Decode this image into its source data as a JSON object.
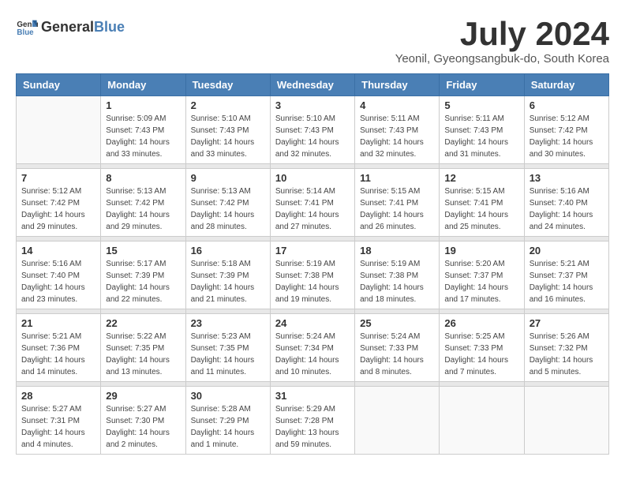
{
  "header": {
    "logo_general": "General",
    "logo_blue": "Blue",
    "month_title": "July 2024",
    "subtitle": "Yeonil, Gyeongsangbuk-do, South Korea"
  },
  "days_of_week": [
    "Sunday",
    "Monday",
    "Tuesday",
    "Wednesday",
    "Thursday",
    "Friday",
    "Saturday"
  ],
  "weeks": [
    {
      "days": [
        {
          "num": "",
          "sunrise": "",
          "sunset": "",
          "daylight": ""
        },
        {
          "num": "1",
          "sunrise": "Sunrise: 5:09 AM",
          "sunset": "Sunset: 7:43 PM",
          "daylight": "Daylight: 14 hours and 33 minutes."
        },
        {
          "num": "2",
          "sunrise": "Sunrise: 5:10 AM",
          "sunset": "Sunset: 7:43 PM",
          "daylight": "Daylight: 14 hours and 33 minutes."
        },
        {
          "num": "3",
          "sunrise": "Sunrise: 5:10 AM",
          "sunset": "Sunset: 7:43 PM",
          "daylight": "Daylight: 14 hours and 32 minutes."
        },
        {
          "num": "4",
          "sunrise": "Sunrise: 5:11 AM",
          "sunset": "Sunset: 7:43 PM",
          "daylight": "Daylight: 14 hours and 32 minutes."
        },
        {
          "num": "5",
          "sunrise": "Sunrise: 5:11 AM",
          "sunset": "Sunset: 7:43 PM",
          "daylight": "Daylight: 14 hours and 31 minutes."
        },
        {
          "num": "6",
          "sunrise": "Sunrise: 5:12 AM",
          "sunset": "Sunset: 7:42 PM",
          "daylight": "Daylight: 14 hours and 30 minutes."
        }
      ]
    },
    {
      "days": [
        {
          "num": "7",
          "sunrise": "Sunrise: 5:12 AM",
          "sunset": "Sunset: 7:42 PM",
          "daylight": "Daylight: 14 hours and 29 minutes."
        },
        {
          "num": "8",
          "sunrise": "Sunrise: 5:13 AM",
          "sunset": "Sunset: 7:42 PM",
          "daylight": "Daylight: 14 hours and 29 minutes."
        },
        {
          "num": "9",
          "sunrise": "Sunrise: 5:13 AM",
          "sunset": "Sunset: 7:42 PM",
          "daylight": "Daylight: 14 hours and 28 minutes."
        },
        {
          "num": "10",
          "sunrise": "Sunrise: 5:14 AM",
          "sunset": "Sunset: 7:41 PM",
          "daylight": "Daylight: 14 hours and 27 minutes."
        },
        {
          "num": "11",
          "sunrise": "Sunrise: 5:15 AM",
          "sunset": "Sunset: 7:41 PM",
          "daylight": "Daylight: 14 hours and 26 minutes."
        },
        {
          "num": "12",
          "sunrise": "Sunrise: 5:15 AM",
          "sunset": "Sunset: 7:41 PM",
          "daylight": "Daylight: 14 hours and 25 minutes."
        },
        {
          "num": "13",
          "sunrise": "Sunrise: 5:16 AM",
          "sunset": "Sunset: 7:40 PM",
          "daylight": "Daylight: 14 hours and 24 minutes."
        }
      ]
    },
    {
      "days": [
        {
          "num": "14",
          "sunrise": "Sunrise: 5:16 AM",
          "sunset": "Sunset: 7:40 PM",
          "daylight": "Daylight: 14 hours and 23 minutes."
        },
        {
          "num": "15",
          "sunrise": "Sunrise: 5:17 AM",
          "sunset": "Sunset: 7:39 PM",
          "daylight": "Daylight: 14 hours and 22 minutes."
        },
        {
          "num": "16",
          "sunrise": "Sunrise: 5:18 AM",
          "sunset": "Sunset: 7:39 PM",
          "daylight": "Daylight: 14 hours and 21 minutes."
        },
        {
          "num": "17",
          "sunrise": "Sunrise: 5:19 AM",
          "sunset": "Sunset: 7:38 PM",
          "daylight": "Daylight: 14 hours and 19 minutes."
        },
        {
          "num": "18",
          "sunrise": "Sunrise: 5:19 AM",
          "sunset": "Sunset: 7:38 PM",
          "daylight": "Daylight: 14 hours and 18 minutes."
        },
        {
          "num": "19",
          "sunrise": "Sunrise: 5:20 AM",
          "sunset": "Sunset: 7:37 PM",
          "daylight": "Daylight: 14 hours and 17 minutes."
        },
        {
          "num": "20",
          "sunrise": "Sunrise: 5:21 AM",
          "sunset": "Sunset: 7:37 PM",
          "daylight": "Daylight: 14 hours and 16 minutes."
        }
      ]
    },
    {
      "days": [
        {
          "num": "21",
          "sunrise": "Sunrise: 5:21 AM",
          "sunset": "Sunset: 7:36 PM",
          "daylight": "Daylight: 14 hours and 14 minutes."
        },
        {
          "num": "22",
          "sunrise": "Sunrise: 5:22 AM",
          "sunset": "Sunset: 7:35 PM",
          "daylight": "Daylight: 14 hours and 13 minutes."
        },
        {
          "num": "23",
          "sunrise": "Sunrise: 5:23 AM",
          "sunset": "Sunset: 7:35 PM",
          "daylight": "Daylight: 14 hours and 11 minutes."
        },
        {
          "num": "24",
          "sunrise": "Sunrise: 5:24 AM",
          "sunset": "Sunset: 7:34 PM",
          "daylight": "Daylight: 14 hours and 10 minutes."
        },
        {
          "num": "25",
          "sunrise": "Sunrise: 5:24 AM",
          "sunset": "Sunset: 7:33 PM",
          "daylight": "Daylight: 14 hours and 8 minutes."
        },
        {
          "num": "26",
          "sunrise": "Sunrise: 5:25 AM",
          "sunset": "Sunset: 7:33 PM",
          "daylight": "Daylight: 14 hours and 7 minutes."
        },
        {
          "num": "27",
          "sunrise": "Sunrise: 5:26 AM",
          "sunset": "Sunset: 7:32 PM",
          "daylight": "Daylight: 14 hours and 5 minutes."
        }
      ]
    },
    {
      "days": [
        {
          "num": "28",
          "sunrise": "Sunrise: 5:27 AM",
          "sunset": "Sunset: 7:31 PM",
          "daylight": "Daylight: 14 hours and 4 minutes."
        },
        {
          "num": "29",
          "sunrise": "Sunrise: 5:27 AM",
          "sunset": "Sunset: 7:30 PM",
          "daylight": "Daylight: 14 hours and 2 minutes."
        },
        {
          "num": "30",
          "sunrise": "Sunrise: 5:28 AM",
          "sunset": "Sunset: 7:29 PM",
          "daylight": "Daylight: 14 hours and 1 minute."
        },
        {
          "num": "31",
          "sunrise": "Sunrise: 5:29 AM",
          "sunset": "Sunset: 7:28 PM",
          "daylight": "Daylight: 13 hours and 59 minutes."
        },
        {
          "num": "",
          "sunrise": "",
          "sunset": "",
          "daylight": ""
        },
        {
          "num": "",
          "sunrise": "",
          "sunset": "",
          "daylight": ""
        },
        {
          "num": "",
          "sunrise": "",
          "sunset": "",
          "daylight": ""
        }
      ]
    }
  ]
}
